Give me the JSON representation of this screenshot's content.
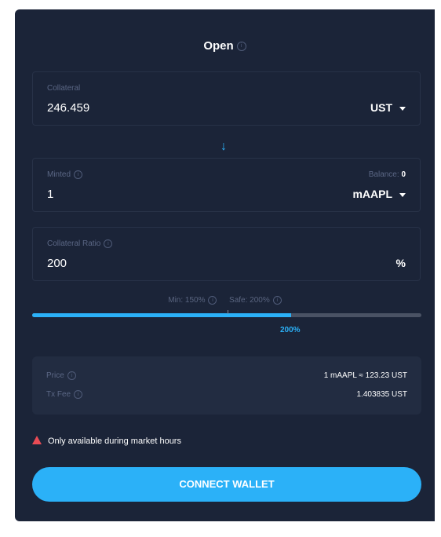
{
  "title": "Open",
  "collateral": {
    "label": "Collateral",
    "value": "246.459",
    "unit": "UST"
  },
  "minted": {
    "label": "Minted",
    "balance_label": "Balance:",
    "balance_value": "0",
    "value": "1",
    "unit": "mAAPL"
  },
  "ratio": {
    "label": "Collateral Ratio",
    "value": "200",
    "unit": "%"
  },
  "slider": {
    "min_label": "Min: 150%",
    "safe_label": "Safe: 200%",
    "value_label": "200%",
    "fill_fraction": 0.665
  },
  "summary": {
    "price_label": "Price",
    "price_value": "1 mAAPL ≈ 123.23 UST",
    "fee_label": "Tx Fee",
    "fee_value": "1.403835 UST"
  },
  "warning": "Only available during market hours",
  "connect_label": "CONNECT WALLET",
  "colors": {
    "accent": "#2bb1f8",
    "panel": "#1b2438",
    "warning": "#e94b55"
  },
  "icons": {
    "info": "info-icon",
    "arrow": "arrow-down-icon",
    "caret": "caret-down-icon",
    "warning": "warning-icon"
  }
}
